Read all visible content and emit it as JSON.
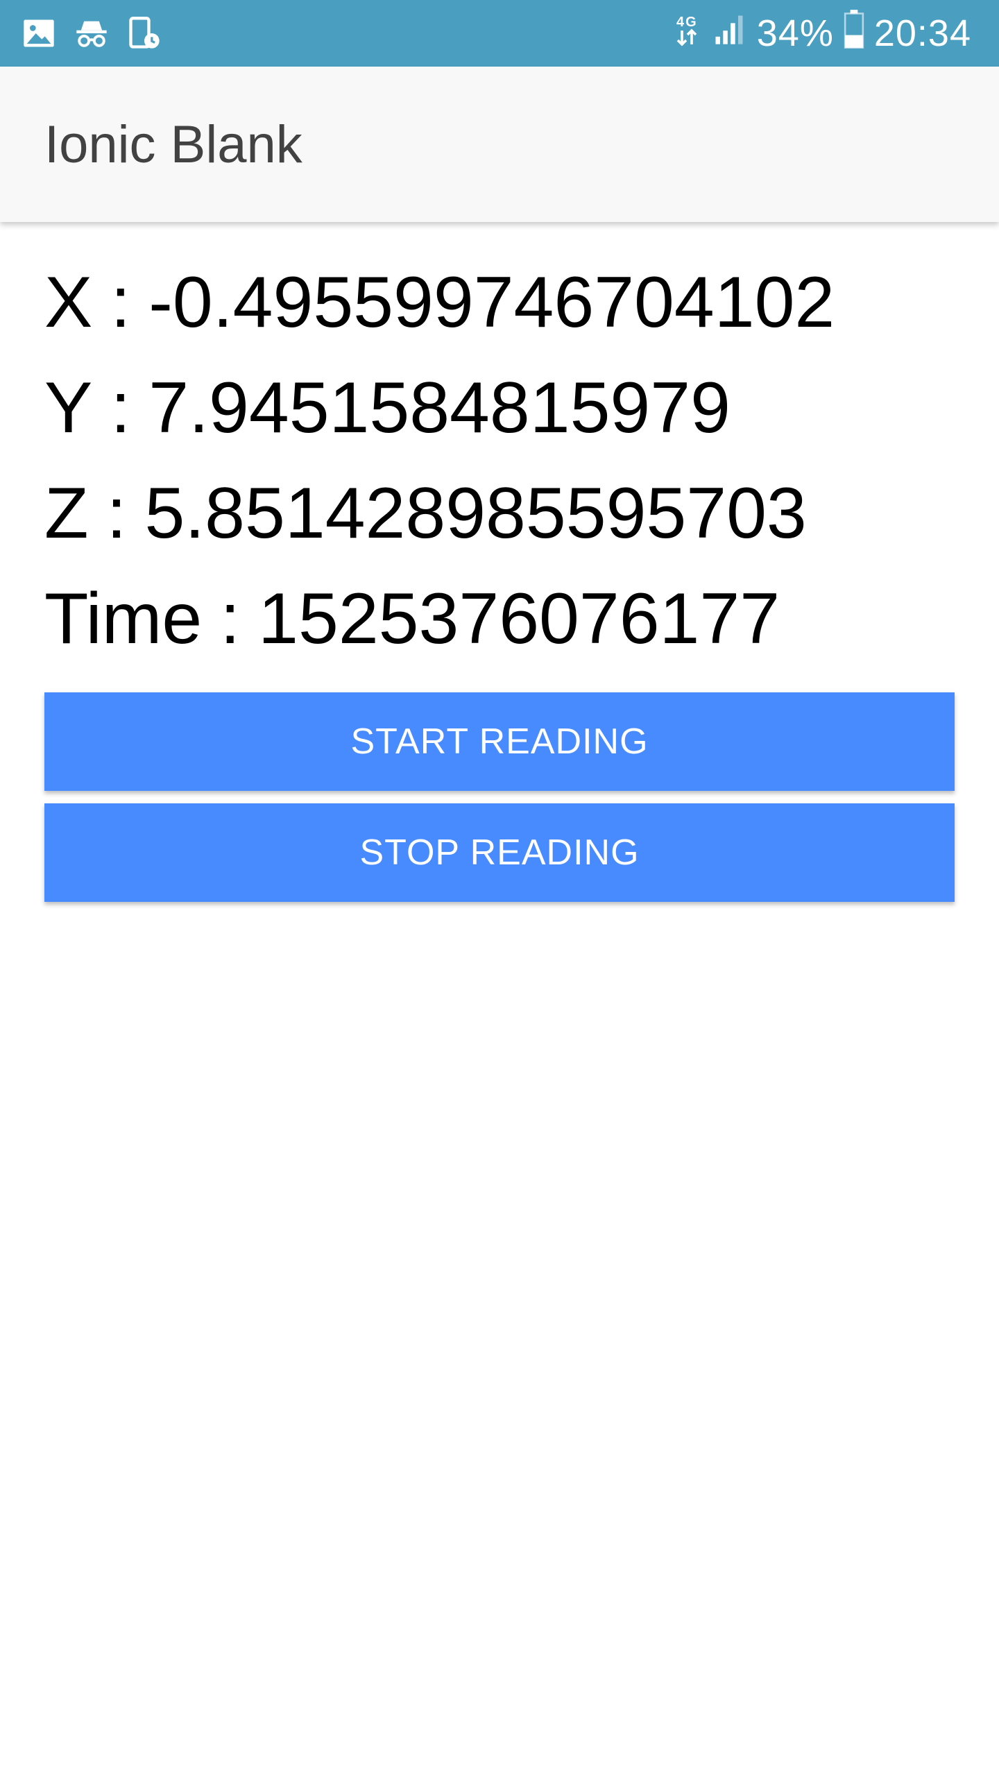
{
  "status_bar": {
    "network": "4G",
    "battery": "34%",
    "time": "20:34",
    "icons": [
      "gallery-icon",
      "incognito-icon",
      "screen-record-icon",
      "network-4g-icon",
      "signal-icon",
      "battery-icon"
    ]
  },
  "toolbar": {
    "title": "Ionic Blank"
  },
  "readings": {
    "x_label": "X",
    "x_value": "-0.495599746704102",
    "y_label": "Y",
    "y_value": "7.9451584815979",
    "z_label": "Z",
    "z_value": "5.851428985595703",
    "time_label": "Time",
    "time_value": "1525376076177",
    "separator": ":"
  },
  "buttons": {
    "start_label": "START READING",
    "stop_label": "STOP READING"
  },
  "colors": {
    "status_bar": "#4a9fc1",
    "toolbar": "#f8f8f8",
    "button": "#488aff"
  }
}
